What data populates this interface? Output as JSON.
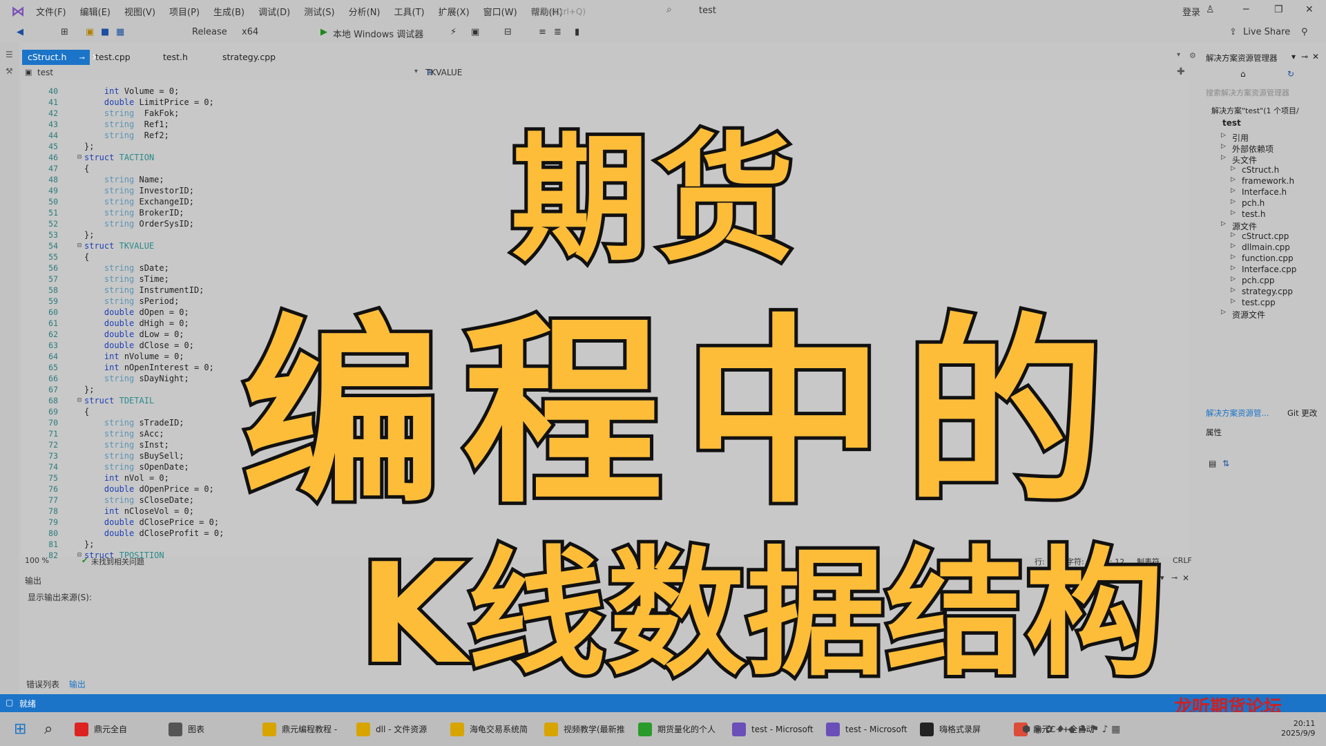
{
  "menubar": {
    "items": [
      "文件(F)",
      "编辑(E)",
      "视图(V)",
      "项目(P)",
      "生成(B)",
      "调试(D)",
      "测试(S)",
      "分析(N)",
      "工具(T)",
      "扩展(X)",
      "窗口(W)",
      "帮助(H)"
    ],
    "search_placeholder": "搜索 (Ctrl+Q)",
    "solution_title": "test",
    "login": "登录"
  },
  "toolbar": {
    "config": "Release",
    "platform": "x64",
    "debugger": "本地 Windows 调试器",
    "live_share": "Live Share"
  },
  "tabs": {
    "active": "cStruct.h",
    "items": [
      "test.cpp",
      "test.h",
      "strategy.cpp"
    ]
  },
  "navbar": {
    "project": "test",
    "symbol": "TKVALUE"
  },
  "code": [
    {
      "n": "40",
      "t": "    int Volume = 0;"
    },
    {
      "n": "41",
      "t": "    double LimitPrice = 0;"
    },
    {
      "n": "42",
      "t": "    string  FakFok;"
    },
    {
      "n": "43",
      "t": "    string  Ref1;"
    },
    {
      "n": "44",
      "t": "    string  Ref2;"
    },
    {
      "n": "45",
      "t": "};"
    },
    {
      "n": "46",
      "t": "struct TACTION"
    },
    {
      "n": "47",
      "t": "{"
    },
    {
      "n": "48",
      "t": "    string Name;"
    },
    {
      "n": "49",
      "t": "    string InvestorID;"
    },
    {
      "n": "50",
      "t": "    string ExchangeID;"
    },
    {
      "n": "51",
      "t": "    string BrokerID;"
    },
    {
      "n": "52",
      "t": "    string OrderSysID;"
    },
    {
      "n": "53",
      "t": "};"
    },
    {
      "n": "54",
      "t": "struct TKVALUE"
    },
    {
      "n": "55",
      "t": "{"
    },
    {
      "n": "56",
      "t": "    string sDate;"
    },
    {
      "n": "57",
      "t": "    string sTime;"
    },
    {
      "n": "58",
      "t": "    string InstrumentID;"
    },
    {
      "n": "59",
      "t": "    string sPeriod;"
    },
    {
      "n": "60",
      "t": "    double dOpen = 0;"
    },
    {
      "n": "61",
      "t": "    double dHigh = 0;"
    },
    {
      "n": "62",
      "t": "    double dLow = 0;"
    },
    {
      "n": "63",
      "t": "    double dClose = 0;"
    },
    {
      "n": "64",
      "t": "    int nVolume = 0;"
    },
    {
      "n": "65",
      "t": "    int nOpenInterest = 0;"
    },
    {
      "n": "66",
      "t": "    string sDayNight;"
    },
    {
      "n": "67",
      "t": "};"
    },
    {
      "n": "68",
      "t": "struct TDETAIL"
    },
    {
      "n": "69",
      "t": "{"
    },
    {
      "n": "70",
      "t": "    string sTradeID;"
    },
    {
      "n": "71",
      "t": "    string sAcc;"
    },
    {
      "n": "72",
      "t": "    string sInst;"
    },
    {
      "n": "73",
      "t": "    string sBuySell;"
    },
    {
      "n": "74",
      "t": "    string sOpenDate;"
    },
    {
      "n": "75",
      "t": "    int nVol = 0;"
    },
    {
      "n": "76",
      "t": "    double dOpenPrice = 0;"
    },
    {
      "n": "77",
      "t": "    string sCloseDate;"
    },
    {
      "n": "78",
      "t": "    int nCloseVol = 0;"
    },
    {
      "n": "79",
      "t": "    double dClosePrice = 0;"
    },
    {
      "n": "80",
      "t": "    double dCloseProfit = 0;"
    },
    {
      "n": "81",
      "t": "};"
    },
    {
      "n": "82",
      "t": "struct TPOSITION"
    }
  ],
  "editor_status": {
    "zoom": "100 %",
    "issues": "未找到相关问题",
    "line": "行: 66",
    "char": "字符: 9",
    "col": "列: 12",
    "tabs": "制表符",
    "eol": "CRLF"
  },
  "output": {
    "title": "输出",
    "source_label": "显示输出来源(S):"
  },
  "bottom_tabs": [
    "错误列表",
    "输出"
  ],
  "solution_explorer": {
    "title": "解决方案资源管理器",
    "search": "搜索解决方案资源管理器",
    "solution": "解决方案\"test\"(1 个项目/",
    "project": "test",
    "items": [
      {
        "label": "引用",
        "lvl": 2
      },
      {
        "label": "外部依赖项",
        "lvl": 2
      },
      {
        "label": "头文件",
        "lvl": 2
      },
      {
        "label": "cStruct.h",
        "lvl": 3
      },
      {
        "label": "framework.h",
        "lvl": 3
      },
      {
        "label": "Interface.h",
        "lvl": 3
      },
      {
        "label": "pch.h",
        "lvl": 3
      },
      {
        "label": "test.h",
        "lvl": 3
      },
      {
        "label": "源文件",
        "lvl": 2
      },
      {
        "label": "cStruct.cpp",
        "lvl": 3
      },
      {
        "label": "dllmain.cpp",
        "lvl": 3
      },
      {
        "label": "function.cpp",
        "lvl": 3
      },
      {
        "label": "Interface.cpp",
        "lvl": 3
      },
      {
        "label": "pch.cpp",
        "lvl": 3
      },
      {
        "label": "strategy.cpp",
        "lvl": 3
      },
      {
        "label": "test.cpp",
        "lvl": 3
      },
      {
        "label": "资源文件",
        "lvl": 2
      }
    ],
    "footer_tab": "解决方案资源管...",
    "git_tab": "Git 更改",
    "props": "属性"
  },
  "overlay": {
    "line1": "期货",
    "line2": "编程中的",
    "line3": "K线数据结构"
  },
  "statusbar": {
    "ready": "就绪",
    "watermark": "龙听期货论坛"
  },
  "taskbar": {
    "items": [
      "鼎元全自",
      "图表",
      "鼎元编程教程 -",
      "dll - 文件资源",
      "海龟交易系统简",
      "视频教学(最新推",
      "期货量化的个人",
      "test - Microsoft",
      "test - Microsoft",
      "嗨格式录屏",
      "鼎元C++全自动"
    ],
    "time": "20:11",
    "date": "2025/9/9"
  },
  "colors": {
    "accent": "#1b74c8",
    "overlay_fill": "#fdbd39",
    "overlay_stroke": "#111111",
    "watermark": "#d02020"
  }
}
